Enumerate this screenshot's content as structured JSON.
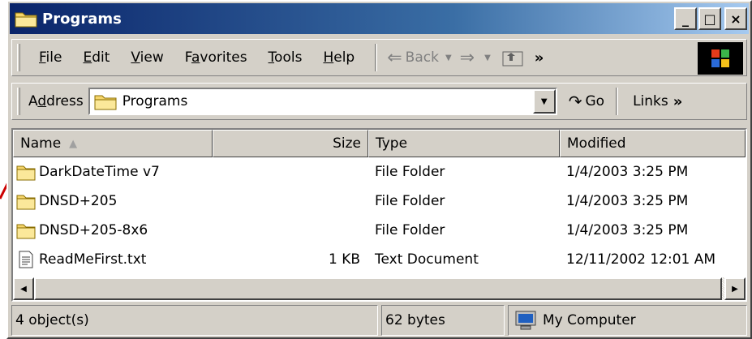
{
  "window": {
    "title": "Programs",
    "caption_buttons": [
      "_",
      "□",
      "×"
    ]
  },
  "menu": {
    "items": [
      {
        "label": "File",
        "accel": "F",
        "rest": "ile"
      },
      {
        "label": "Edit",
        "accel": "E",
        "rest": "dit"
      },
      {
        "label": "View",
        "accel": "V",
        "rest": "iew"
      },
      {
        "label": "Favorites",
        "accel": "a",
        "pre": "F",
        "rest": "vorites"
      },
      {
        "label": "Tools",
        "accel": "T",
        "rest": "ools"
      },
      {
        "label": "Help",
        "accel": "H",
        "rest": "elp"
      }
    ],
    "back_label": "Back",
    "chevron": "»"
  },
  "address": {
    "label_pre": "A",
    "label_accel": "d",
    "label_rest": "dress",
    "value": "Programs",
    "go_label": "Go",
    "links_label": "Links",
    "chevron": "»"
  },
  "columns": {
    "name": "Name",
    "size": "Size",
    "type": "Type",
    "modified": "Modified",
    "sort_indicator": "▲"
  },
  "files": [
    {
      "name": "DarkDateTime v7",
      "size": "",
      "type": "File Folder",
      "modified": "1/4/2003 3:25 PM",
      "icon": "folder-icon"
    },
    {
      "name": "DNSD+205",
      "size": "",
      "type": "File Folder",
      "modified": "1/4/2003 3:25 PM",
      "icon": "folder-icon"
    },
    {
      "name": "DNSD+205-8x6",
      "size": "",
      "type": "File Folder",
      "modified": "1/4/2003 3:25 PM",
      "icon": "folder-icon"
    },
    {
      "name": "ReadMeFirst.txt",
      "size": "1 KB",
      "type": "Text Document",
      "modified": "12/11/2002 12:01 AM",
      "icon": "text-file-icon"
    }
  ],
  "status": {
    "objects": "4 object(s)",
    "bytes": "62 bytes",
    "zone": "My Computer"
  },
  "colors": {
    "title_bar": "#0a246a",
    "window_face": "#d4d0c8",
    "folder": "#f5d56b",
    "annotation_arrow": "#cc0000"
  }
}
